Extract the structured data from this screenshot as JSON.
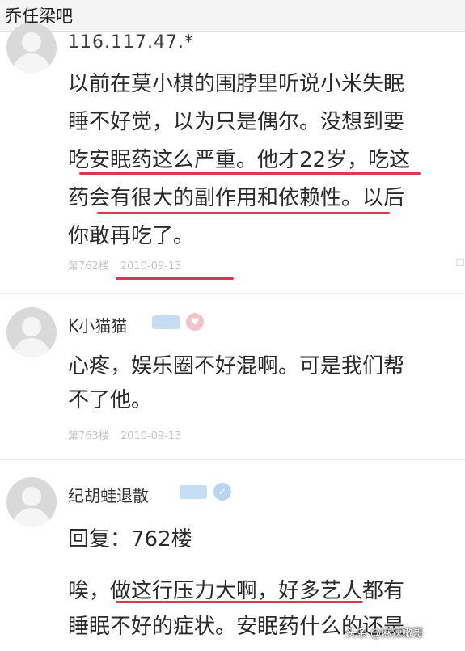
{
  "header": {
    "title": "乔任梁吧"
  },
  "posts": [
    {
      "ip": "116.117.47.*",
      "lines": [
        "以前在莫小棋的围脖里听说小米失眠",
        "睡不好觉，以为只是偶尔。没想到要",
        "吃安眠药这么严重。他才22岁，吃这",
        "药会有很大的副作用和依赖性。以后",
        "你敢再吃了。"
      ],
      "floor": "第762楼",
      "date": "2010-09-13"
    },
    {
      "username": "K小猫猫",
      "lines": [
        "心疼，娱乐圈不好混啊。可是我们帮",
        "不了他。"
      ],
      "floor": "第763楼",
      "date": "2010-09-13"
    },
    {
      "username": "纪胡蛙退散",
      "lines": [
        "回复：762楼",
        "唉，做这行压力大啊，好多艺人都有",
        "睡眠不好的症状。安眠药什么的还是"
      ]
    }
  ],
  "watermark": "头条 @麻辣嫩哥",
  "colors": {
    "underline": "#e0374f",
    "badge": "#c6dcf3",
    "meta": "#c5c5c5"
  }
}
